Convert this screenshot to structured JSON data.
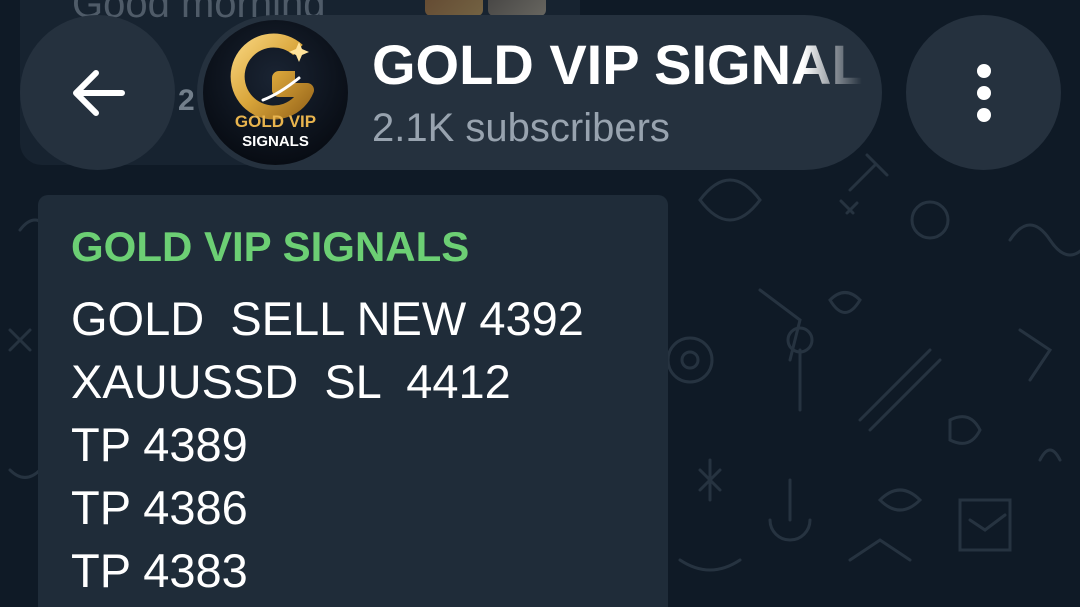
{
  "header": {
    "back_icon": "arrow-left-icon",
    "channel_title": "GOLD VIP SIGNAL",
    "channel_subtitle": "2.1K subscribers",
    "avatar_text_line1": "GOLD VIP",
    "avatar_text_line2": "SIGNALS",
    "menu_icon": "more-vertical-icon"
  },
  "previous_message": {
    "text": "Good morning",
    "partial_label": "2"
  },
  "message": {
    "sender": "GOLD VIP SIGNALS",
    "lines": [
      "GOLD  SELL NEW 4392",
      "XAUUSSD  SL  4412",
      "TP 4389",
      "TP 4386",
      "TP 4383"
    ]
  },
  "colors": {
    "background": "#0f1a26",
    "bubble": "#1f2c39",
    "header_pill": "#25313e",
    "sender_name": "#6ccf74",
    "subtitle": "#98a3af",
    "gold": "#d9a53a"
  }
}
